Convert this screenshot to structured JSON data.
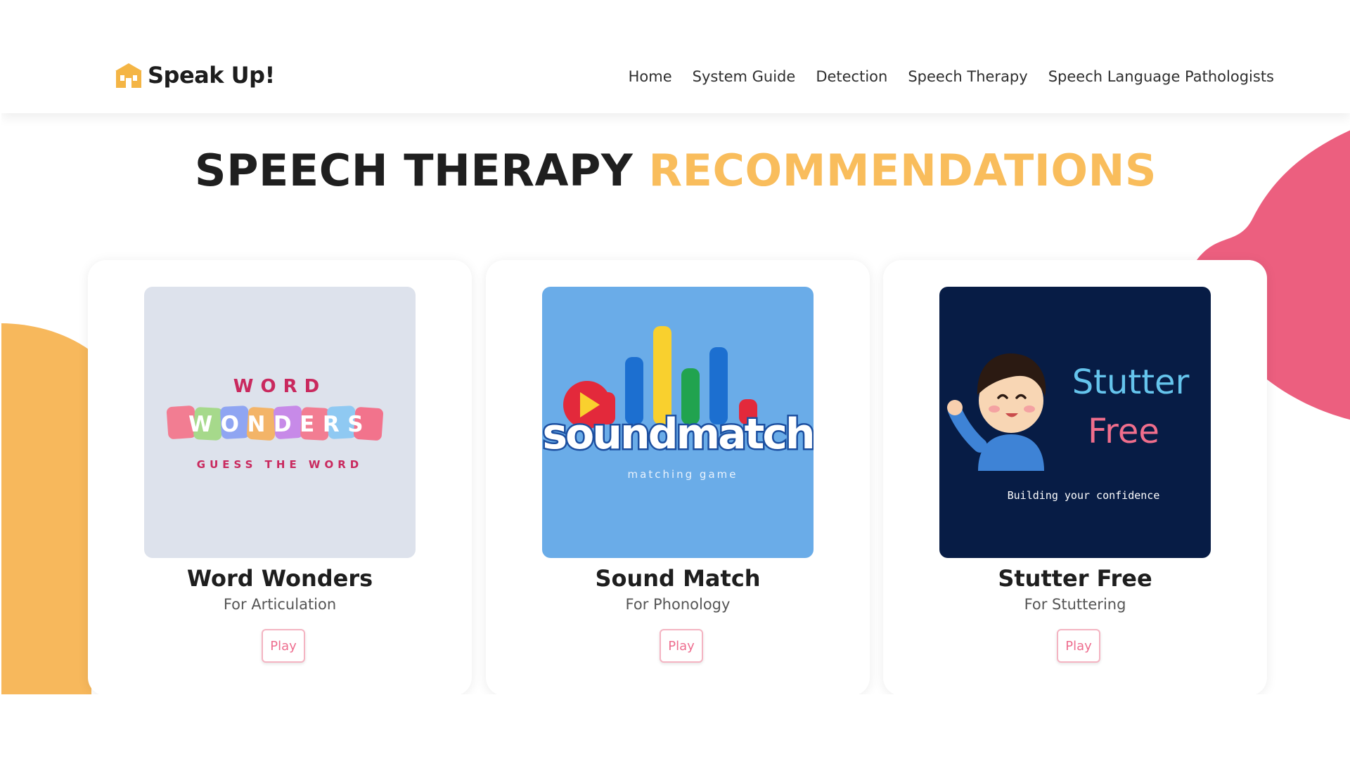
{
  "brand": {
    "name": "Speak Up!"
  },
  "nav": {
    "items": [
      "Home",
      "System Guide",
      "Detection",
      "Speech Therapy",
      "Speech Language Pathologists"
    ]
  },
  "page": {
    "title_part1": "SPEECH THERAPY",
    "title_part2": "RECOMMENDATIONS"
  },
  "cards": [
    {
      "name": "Word Wonders",
      "subtitle": "For Articulation",
      "button": "Play",
      "thumbnail": {
        "line1": "WORD",
        "line2": "WONDERS",
        "line3": "GUESS THE WORD",
        "background": "#dde2ec"
      }
    },
    {
      "name": "Sound Match",
      "subtitle": "For Phonology",
      "button": "Play",
      "thumbnail": {
        "line1": "soundmatch",
        "line2": "matching game",
        "background": "#6aace8"
      }
    },
    {
      "name": "Stutter Free",
      "subtitle": "For Stuttering",
      "button": "Play",
      "thumbnail": {
        "line1": "Stutter",
        "line2": "Free",
        "line3": "Building your confidence",
        "background": "#071c45"
      }
    }
  ],
  "colors": {
    "accent_orange": "#f9bd5c",
    "accent_pink": "#ec5f7f",
    "play_text": "#ee6e8f"
  }
}
